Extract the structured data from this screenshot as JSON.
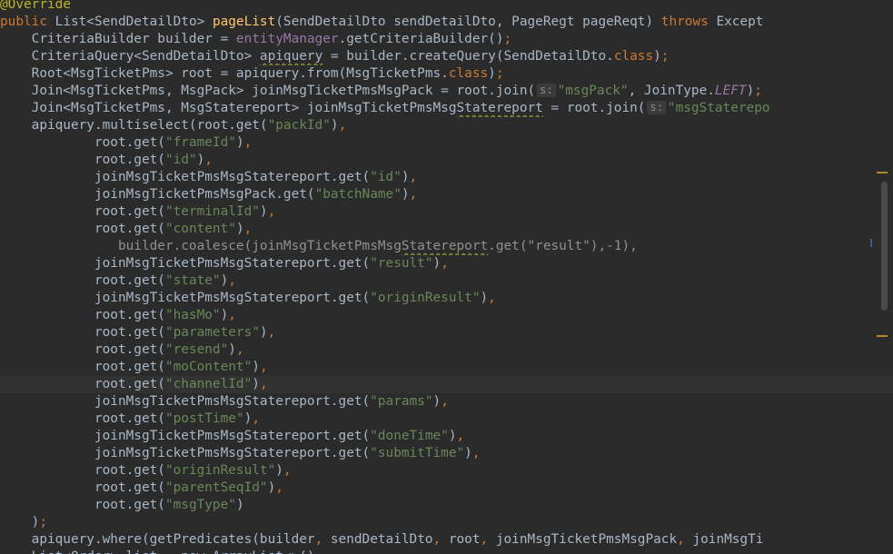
{
  "editor": {
    "lines": [
      [
        {
          "t": "@Override",
          "c": "ann"
        }
      ],
      [
        {
          "t": "public ",
          "c": "kw"
        },
        {
          "t": "List<SendDetailDto> ",
          "c": "text"
        },
        {
          "t": "pageList",
          "c": "fn"
        },
        {
          "t": "(SendDetailDto sendDetailDto, PageRegt pageReqt) ",
          "c": "text"
        },
        {
          "t": "throws ",
          "c": "kw"
        },
        {
          "t": "Except",
          "c": "text"
        }
      ],
      [
        {
          "t": "    CriteriaBuilder builder = ",
          "c": "text"
        },
        {
          "t": "entityManager",
          "c": "field"
        },
        {
          "t": ".getCriteriaBuilder()",
          "c": "text"
        },
        {
          "t": ";",
          "c": "kw"
        }
      ],
      [
        {
          "t": "    CriteriaQuery<SendDetailDto> ",
          "c": "text"
        },
        {
          "t": "apiquery",
          "c": "text",
          "w": true
        },
        {
          "t": " = builder.createQuery(SendDetailDto.",
          "c": "text"
        },
        {
          "t": "class",
          "c": "kw"
        },
        {
          "t": ")",
          "c": "text"
        },
        {
          "t": ";",
          "c": "kw"
        }
      ],
      [
        {
          "t": "    Root<MsgTicketPms> root = apiquery.from(MsgTicketPms.",
          "c": "text"
        },
        {
          "t": "class",
          "c": "kw"
        },
        {
          "t": ")",
          "c": "text"
        },
        {
          "t": ";",
          "c": "kw"
        }
      ],
      [
        {
          "t": "    Join<MsgTicketPms, MsgPack> joinMsgTicketPmsMsgPack = root.join(",
          "c": "text"
        },
        {
          "t": "s:",
          "c": "hint"
        },
        {
          "t": "\"msgPack\"",
          "c": "str"
        },
        {
          "t": ", JoinType.",
          "c": "text"
        },
        {
          "t": "LEFT",
          "c": "const"
        },
        {
          "t": ")",
          "c": "text"
        },
        {
          "t": ";",
          "c": "kw"
        }
      ],
      [
        {
          "t": "    Join<MsgTicketPms, MsgStatereport> joinMsgTicketPmsMsg",
          "c": "text"
        },
        {
          "t": "Statereport",
          "c": "text",
          "w": true
        },
        {
          "t": " = root.join(",
          "c": "text"
        },
        {
          "t": "s:",
          "c": "hint"
        },
        {
          "t": "\"msgStaterepo",
          "c": "str"
        }
      ],
      [
        {
          "t": "    apiquery.multiselect(root.get(",
          "c": "text"
        },
        {
          "t": "\"packId\"",
          "c": "str"
        },
        {
          "t": ")",
          "c": "text"
        },
        {
          "t": ",",
          "c": "kw"
        }
      ],
      [
        {
          "t": "            root.get(",
          "c": "text"
        },
        {
          "t": "\"frameId\"",
          "c": "str"
        },
        {
          "t": ")",
          "c": "text"
        },
        {
          "t": ",",
          "c": "kw"
        }
      ],
      [
        {
          "t": "            root.get(",
          "c": "text"
        },
        {
          "t": "\"id\"",
          "c": "str"
        },
        {
          "t": ")",
          "c": "text"
        },
        {
          "t": ",",
          "c": "kw"
        }
      ],
      [
        {
          "t": "            joinMsgTicketPmsMsgStatereport.get(",
          "c": "text"
        },
        {
          "t": "\"id\"",
          "c": "str"
        },
        {
          "t": ")",
          "c": "text"
        },
        {
          "t": ",",
          "c": "kw"
        }
      ],
      [
        {
          "t": "            joinMsgTicketPmsMsgPack.get(",
          "c": "text"
        },
        {
          "t": "\"batchName\"",
          "c": "str"
        },
        {
          "t": ")",
          "c": "text"
        },
        {
          "t": ",",
          "c": "kw"
        }
      ],
      [
        {
          "t": "            root.get(",
          "c": "text"
        },
        {
          "t": "\"terminalId\"",
          "c": "str"
        },
        {
          "t": ")",
          "c": "text"
        },
        {
          "t": ",",
          "c": "kw"
        }
      ],
      [
        {
          "t": "            root.get(",
          "c": "text"
        },
        {
          "t": "\"content\"",
          "c": "str"
        },
        {
          "t": ")",
          "c": "text"
        },
        {
          "t": ",",
          "c": "kw"
        }
      ],
      [
        {
          "t": "               builder.coalesce(joinMsgTicketPmsMsg",
          "c": "dim"
        },
        {
          "t": "Statereport",
          "c": "dim",
          "w": true
        },
        {
          "t": ".get(\"result\"),-1),",
          "c": "dim"
        }
      ],
      [
        {
          "t": "            joinMsgTicketPmsMsgStatereport.get(",
          "c": "text"
        },
        {
          "t": "\"result\"",
          "c": "str"
        },
        {
          "t": ")",
          "c": "text"
        },
        {
          "t": ",",
          "c": "kw"
        }
      ],
      [
        {
          "t": "            root.get(",
          "c": "text"
        },
        {
          "t": "\"state\"",
          "c": "str"
        },
        {
          "t": ")",
          "c": "text"
        },
        {
          "t": ",",
          "c": "kw"
        }
      ],
      [
        {
          "t": "            joinMsgTicketPmsMsgStatereport.get(",
          "c": "text"
        },
        {
          "t": "\"originResult\"",
          "c": "str"
        },
        {
          "t": ")",
          "c": "text"
        },
        {
          "t": ",",
          "c": "kw"
        }
      ],
      [
        {
          "t": "            root.get(",
          "c": "text"
        },
        {
          "t": "\"hasMo\"",
          "c": "str"
        },
        {
          "t": ")",
          "c": "text"
        },
        {
          "t": ",",
          "c": "kw"
        }
      ],
      [
        {
          "t": "            root.get(",
          "c": "text"
        },
        {
          "t": "\"parameters\"",
          "c": "str"
        },
        {
          "t": ")",
          "c": "text"
        },
        {
          "t": ",",
          "c": "kw"
        }
      ],
      [
        {
          "t": "            root.get(",
          "c": "text"
        },
        {
          "t": "\"resend\"",
          "c": "str"
        },
        {
          "t": ")",
          "c": "text"
        },
        {
          "t": ",",
          "c": "kw"
        }
      ],
      [
        {
          "t": "            root.get(",
          "c": "text"
        },
        {
          "t": "\"moContent\"",
          "c": "str"
        },
        {
          "t": ")",
          "c": "text"
        },
        {
          "t": ",",
          "c": "kw"
        }
      ],
      [
        {
          "t": "            root.get(",
          "c": "text"
        },
        {
          "t": "\"channelId\"",
          "c": "str"
        },
        {
          "t": ")",
          "c": "text"
        },
        {
          "t": ",",
          "c": "kw"
        }
      ],
      [
        {
          "t": "            joinMsgTicketPmsMsgStatereport.get(",
          "c": "text"
        },
        {
          "t": "\"params\"",
          "c": "str"
        },
        {
          "t": ")",
          "c": "text"
        },
        {
          "t": ",",
          "c": "kw"
        }
      ],
      [
        {
          "t": "            root.get(",
          "c": "text"
        },
        {
          "t": "\"postTime\"",
          "c": "str"
        },
        {
          "t": ")",
          "c": "text"
        },
        {
          "t": ",",
          "c": "kw"
        }
      ],
      [
        {
          "t": "            joinMsgTicketPmsMsgStatereport.get(",
          "c": "text"
        },
        {
          "t": "\"doneTime\"",
          "c": "str"
        },
        {
          "t": ")",
          "c": "text"
        },
        {
          "t": ",",
          "c": "kw"
        }
      ],
      [
        {
          "t": "            joinMsgTicketPmsMsgStatereport.get(",
          "c": "text"
        },
        {
          "t": "\"submitTime\"",
          "c": "str"
        },
        {
          "t": ")",
          "c": "text"
        },
        {
          "t": ",",
          "c": "kw"
        }
      ],
      [
        {
          "t": "            root.get(",
          "c": "text"
        },
        {
          "t": "\"originResult\"",
          "c": "str"
        },
        {
          "t": ")",
          "c": "text"
        },
        {
          "t": ",",
          "c": "kw"
        }
      ],
      [
        {
          "t": "            root.get(",
          "c": "text"
        },
        {
          "t": "\"parentSeqId\"",
          "c": "str"
        },
        {
          "t": ")",
          "c": "text"
        },
        {
          "t": ",",
          "c": "kw"
        }
      ],
      [
        {
          "t": "            root.get(",
          "c": "text"
        },
        {
          "t": "\"msgType\"",
          "c": "str"
        },
        {
          "t": ")",
          "c": "text"
        }
      ],
      [
        {
          "t": "    )",
          "c": "text"
        },
        {
          "t": ";",
          "c": "kw"
        }
      ],
      [
        {
          "t": "    apiquery.where(getPredicates(builder",
          "c": "text"
        },
        {
          "t": ", ",
          "c": "kw"
        },
        {
          "t": "sendDetailDto",
          "c": "text"
        },
        {
          "t": ", ",
          "c": "kw"
        },
        {
          "t": "root",
          "c": "text"
        },
        {
          "t": ", ",
          "c": "kw"
        },
        {
          "t": "joinMsgTicketPmsMsgPack",
          "c": "text"
        },
        {
          "t": ", ",
          "c": "kw"
        },
        {
          "t": "joinMsgTi",
          "c": "text"
        }
      ],
      [
        {
          "t": "    List<Order> list = new ArrayList<>()",
          "c": "text"
        }
      ]
    ],
    "current_line_index": 22
  }
}
